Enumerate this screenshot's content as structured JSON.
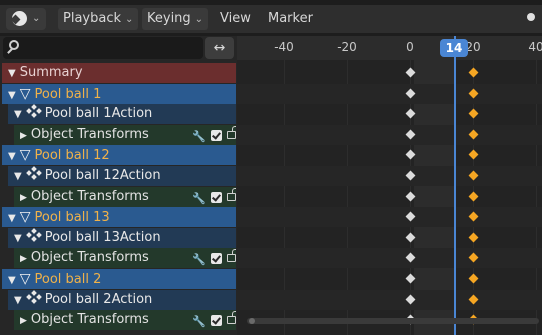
{
  "header": {
    "editor_icon": "dopesheet-icon",
    "menus": [
      "Playback",
      "Keying",
      "View",
      "Marker"
    ]
  },
  "search": {
    "placeholder": "",
    "sync_icon": "↔"
  },
  "channels": [
    {
      "type": "summary",
      "label": "Summary"
    },
    {
      "type": "object",
      "label": "Pool ball 1"
    },
    {
      "type": "action",
      "label": "Pool ball 1Action"
    },
    {
      "type": "group",
      "label": "Object Transforms"
    },
    {
      "type": "object",
      "label": "Pool ball 12"
    },
    {
      "type": "action",
      "label": "Pool ball 12Action"
    },
    {
      "type": "group",
      "label": "Object Transforms"
    },
    {
      "type": "object",
      "label": "Pool ball 13"
    },
    {
      "type": "action",
      "label": "Pool ball 13Action"
    },
    {
      "type": "group",
      "label": "Object Transforms"
    },
    {
      "type": "object",
      "label": "Pool ball 2"
    },
    {
      "type": "action",
      "label": "Pool ball 2Action"
    },
    {
      "type": "group",
      "label": "Object Transforms"
    }
  ],
  "timeline": {
    "ticks": [
      "-40",
      "-20",
      "0",
      "20",
      "40"
    ],
    "current_frame": "14",
    "keyframe_frames": [
      0,
      20
    ],
    "colors": {
      "playhead": "#4a86d4",
      "selected_key": "#f5a623",
      "unselected_key": "#dcdcdc"
    }
  }
}
